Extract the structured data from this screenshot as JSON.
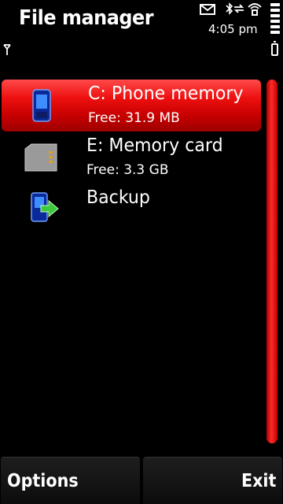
{
  "window": {
    "title": "File manager"
  },
  "status": {
    "time": "4:05 pm",
    "icons": [
      "mail-icon",
      "bluetooth-icon",
      "sync-icon",
      "wlan-icon",
      "battery-level-icon",
      "signal-icon",
      "battery-icon"
    ]
  },
  "drives": [
    {
      "name": "C: Phone memory",
      "free": "Free: 31.9 MB",
      "icon": "phone-icon",
      "selected": true
    },
    {
      "name": "E: Memory card",
      "free": "Free: 3.3 GB",
      "icon": "memory-card-icon",
      "selected": false
    },
    {
      "name": "Backup",
      "free": "",
      "icon": "backup-icon",
      "selected": false
    }
  ],
  "softkeys": {
    "left": "Options",
    "right": "Exit"
  },
  "colors": {
    "accent": "#e00000",
    "background": "#000000",
    "text": "#ffffff"
  }
}
